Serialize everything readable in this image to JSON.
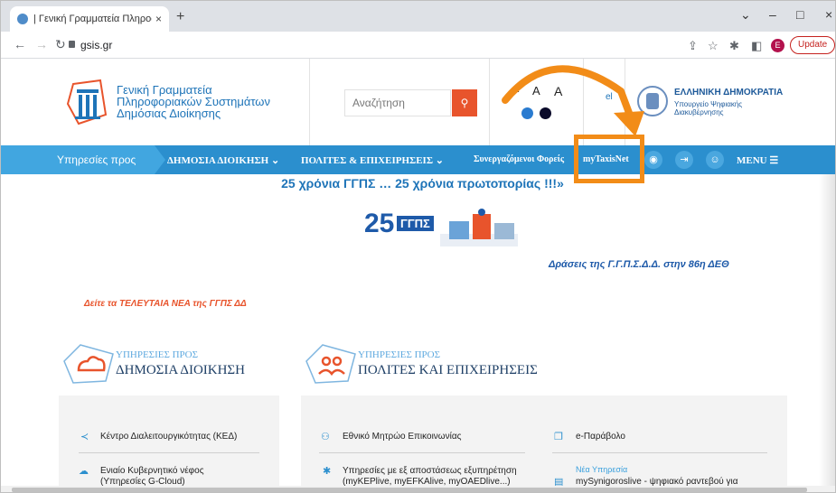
{
  "browser": {
    "tab_title": "| Γενική Γραμματεία Πληροφορια",
    "tab_close": "×",
    "new_tab": "+",
    "url": "gsis.gr",
    "update_label": "Update",
    "profile_initial": "E",
    "win_min": "–",
    "win_max": "□",
    "win_close": "×",
    "win_dropdown": "⌄"
  },
  "header": {
    "org_line1": "Γενική Γραμματεία",
    "org_line2": "Πληροφοριακών Συστημάτων",
    "org_line3": "Δημόσιας Διοίκησης",
    "search_placeholder": "Αναζήτηση",
    "font_size_labels": [
      "A",
      "A",
      "A"
    ],
    "lang_link": "el",
    "gov_title": "ΕΛΛΗΝΙΚΗ ΔΗΜΟΚΡΑΤΙΑ",
    "gov_ministry": "Υπουργείο Ψηφιακής Διακυβέρνησης",
    "colors": {
      "accent": "#f28c18",
      "brand": "#2b8fce",
      "search_btn": "#e8542c",
      "dot1": "#2a7bd0",
      "dot2": "#0a0a2a"
    }
  },
  "nav": {
    "services_for": "Υπηρεσίες προς",
    "public_admin": "ΔΗΜΟΣΙΑ ΔΙΟΙΚΗΣΗ",
    "citizens": "ΠΟΛΙΤΕΣ & ΕΠΙΧΕΙΡΗΣΕΙΣ",
    "partners": "Συνεργαζόμενοι Φορείς",
    "mytaxisnet": "myTaxisNet",
    "menu": "MENU",
    "icons": [
      "rss-icon",
      "login-icon",
      "user-icon",
      "hamburger-icon"
    ]
  },
  "banner": {
    "anniversary": "25 χρόνια ΓΓΠΣ … 25 χρόνια πρωτοπορίας !!!»",
    "logo_number": "25",
    "logo_text": "ΓΓΠΣ",
    "deth_link": "Δράσεις της Γ.Γ.Π.Σ.Δ.Δ. στην 86η ΔΕΘ",
    "news_link": "Δείτε τα ΤΕΛΕΥΤΑΙΑ ΝΕΑ της ΓΓΠΣ ΔΔ"
  },
  "sections": {
    "public": {
      "small": "ΥΠΗΡΕΣΙΕΣ ΠΡΟΣ",
      "big": "ΔΗΜΟΣΙΑ ΔΙΟΙΚΗΣΗ"
    },
    "citizens": {
      "small": "ΥΠΗΡΕΣΙΕΣ ΠΡΟΣ",
      "big": "ΠΟΛΙΤΕΣ ΚΑΙ ΕΠΙΧΕΙΡΗΣΕΙΣ"
    }
  },
  "items": {
    "ked": "Κέντρο Διαλειτουργικότητας (ΚΕΔ)",
    "cloud_1": "Ενιαίο Κυβερνητικό νέφος",
    "cloud_2": "(Υπηρεσίες G-Cloud)",
    "registry": "Εθνικό Μητρώο Επικοινωνίας",
    "remote_1": "Υπηρεσίες με εξ αποστάσεως εξυπηρέτηση",
    "remote_2": "(myKEPlive, myEFKAlive, myOAEDlive...)",
    "eparavolo": "e-Παράβολο",
    "new_service": "Νέα Υπηρεσία",
    "synigoros": "mySynigoroslive - ψηφιακό ραντεβού για"
  }
}
